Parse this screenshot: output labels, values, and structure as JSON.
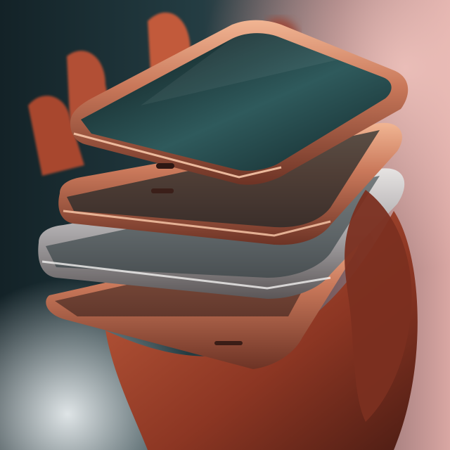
{
  "image": {
    "subject": "hand-holding-stacked-smartphones",
    "palette": {
      "background_dark": "#16262c",
      "background_teal": "#2b4a50",
      "background_pink": "#d9a7a3",
      "skin": "#b8543a",
      "skin_shadow": "#5a2418",
      "copper_frame": "#c97858",
      "copper_highlight": "#f2b79a",
      "silver_frame": "#b9b6b8",
      "screen_dark": "#0e1a1d",
      "screen_teal": "#2f5a5c"
    }
  }
}
